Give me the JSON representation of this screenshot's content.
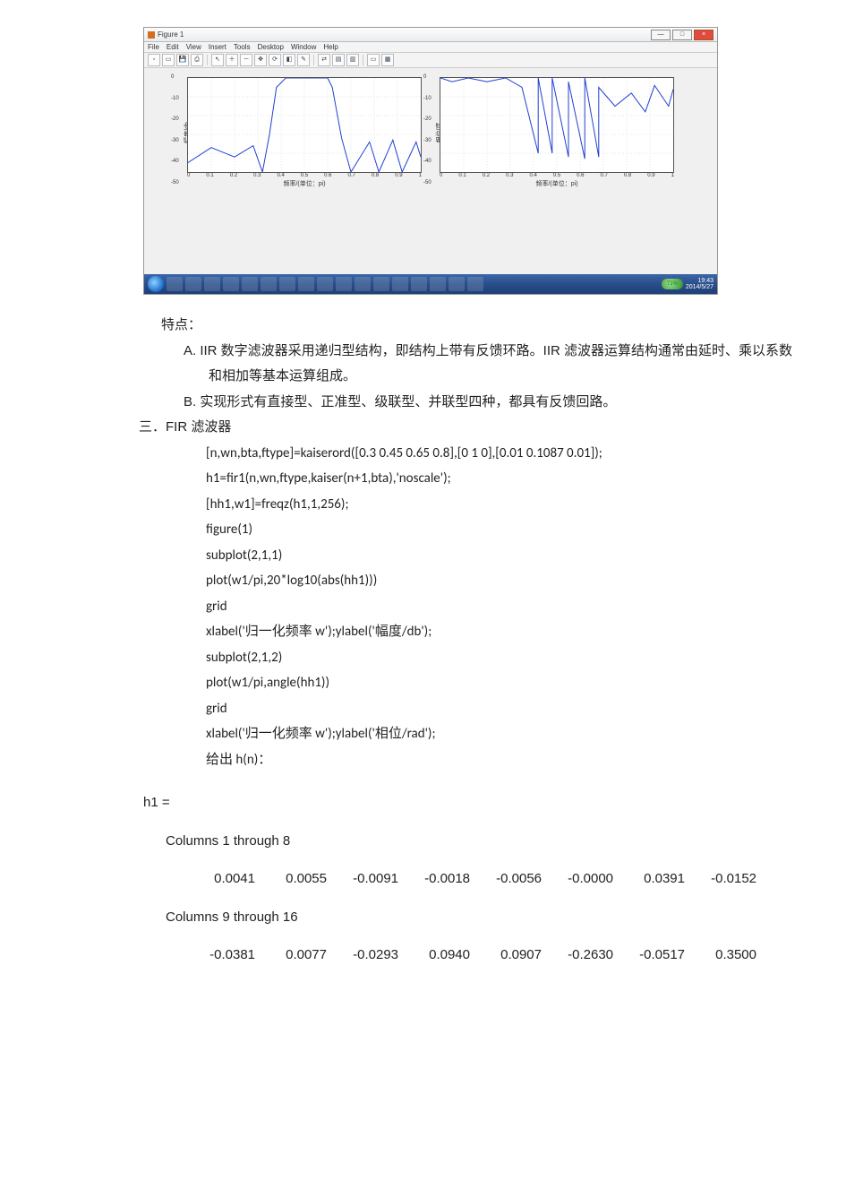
{
  "matlab_figure": {
    "window_title": "Figure 1",
    "menubar": [
      "File",
      "Edit",
      "View",
      "Insert",
      "Tools",
      "Desktop",
      "Window",
      "Help"
    ],
    "win_buttons": {
      "min": "—",
      "max": "□",
      "close": "×"
    },
    "toolbar_items": 18,
    "battery_pct": "73%",
    "clock_time": "19:43",
    "clock_date": "2014/5/27",
    "taskbar_item_count": 18,
    "plots": [
      {
        "xlabel": "频率/(单位：pi)",
        "ylabel": "幅度/db",
        "xlim": [
          0,
          1
        ],
        "ylim": [
          -50,
          0
        ],
        "xticks": [
          "0",
          "0.1",
          "0.2",
          "0.3",
          "0.4",
          "0.5",
          "0.6",
          "0.7",
          "0.8",
          "0.9",
          "1"
        ],
        "yticks": [
          "0",
          "-10",
          "-20",
          "-30",
          "-40",
          "-50"
        ]
      },
      {
        "xlabel": "频率/(单位：pi)",
        "ylabel": "相位/度",
        "xlim": [
          0,
          1
        ],
        "ylim": [
          -50,
          0
        ],
        "xticks": [
          "0",
          "0.1",
          "0.2",
          "0.3",
          "0.4",
          "0.5",
          "0.6",
          "0.7",
          "0.8",
          "0.9",
          "1"
        ],
        "yticks": [
          "0",
          "-10",
          "-20",
          "-30",
          "-40",
          "-50"
        ]
      }
    ]
  },
  "chart_data": [
    {
      "type": "line",
      "title": "",
      "xlabel": "频率/(单位：pi)",
      "ylabel": "幅度/db",
      "xlim": [
        0,
        1
      ],
      "ylim": [
        -50,
        0
      ],
      "series": [
        {
          "name": "magnitude",
          "x": [
            0.0,
            0.1,
            0.2,
            0.28,
            0.32,
            0.35,
            0.38,
            0.42,
            0.45,
            0.5,
            0.55,
            0.6,
            0.62,
            0.66,
            0.7,
            0.78,
            0.82,
            0.88,
            0.92,
            0.98,
            1.0
          ],
          "y": [
            -45,
            -37,
            -42,
            -36,
            -50,
            -30,
            -5,
            0,
            0,
            0,
            0,
            0,
            -5,
            -32,
            -50,
            -34,
            -50,
            -33,
            -50,
            -34,
            -42
          ]
        }
      ]
    },
    {
      "type": "line",
      "title": "",
      "xlabel": "频率/(单位：pi)",
      "ylabel": "相位/度",
      "xlim": [
        0,
        1
      ],
      "ylim": [
        -50,
        0
      ],
      "series": [
        {
          "name": "phase",
          "x": [
            0.0,
            0.05,
            0.12,
            0.2,
            0.28,
            0.35,
            0.42,
            0.42,
            0.48,
            0.48,
            0.55,
            0.55,
            0.62,
            0.62,
            0.68,
            0.68,
            0.75,
            0.82,
            0.88,
            0.92,
            0.98,
            1.0
          ],
          "y": [
            0,
            -2,
            0,
            -2,
            0,
            -5,
            -40,
            0,
            -40,
            0,
            -42,
            -2,
            -43,
            0,
            -42,
            -5,
            -15,
            -8,
            -18,
            -4,
            -15,
            -6
          ]
        }
      ]
    }
  ],
  "doc": {
    "tedian_label": "特点：",
    "point_a": "A.  IIR 数字滤波器采用递归型结构，即结构上带有反馈环路。IIR 滤波器运算结构通常由延时、乘以系数和相加等基本运算组成。",
    "point_b": "B.  实现形式有直接型、正准型、级联型、并联型四种，都具有反馈回路。",
    "section3": "三．FIR 滤波器",
    "code_lines": [
      "[n,wn,bta,ftype]=kaiserord([0.3    0.45    0.65    0.8],[0    1    0],[0.01    0.1087    0.01]);",
      "h1=fir1(n,wn,ftype,kaiser(n+1,bta),'noscale');",
      "[hh1,w1]=freqz(h1,1,256);",
      "figure(1)",
      "subplot(2,1,1)",
      "plot(w1/pi,20*log10(abs(hh1)))",
      "grid",
      "xlabel('归一化频率 w');ylabel('幅度/db');",
      "subplot(2,1,2)",
      "plot(w1/pi,angle(hh1))",
      "grid",
      "xlabel('归一化频率 w');ylabel('相位/rad');",
      "给出 h(n)："
    ],
    "h1_label": "h1 =",
    "cols_1_8": "Columns  1  through  8",
    "row1": [
      "0.0041",
      "0.0055",
      "-0.0091",
      "-0.0018",
      "-0.0056",
      "-0.0000",
      "0.0391",
      "-0.0152"
    ],
    "cols_9_16": "Columns  9  through  16",
    "row2": [
      "-0.0381",
      "0.0077",
      "-0.0293",
      "0.0940",
      "0.0907",
      "-0.2630",
      "-0.0517",
      "0.3500"
    ]
  }
}
